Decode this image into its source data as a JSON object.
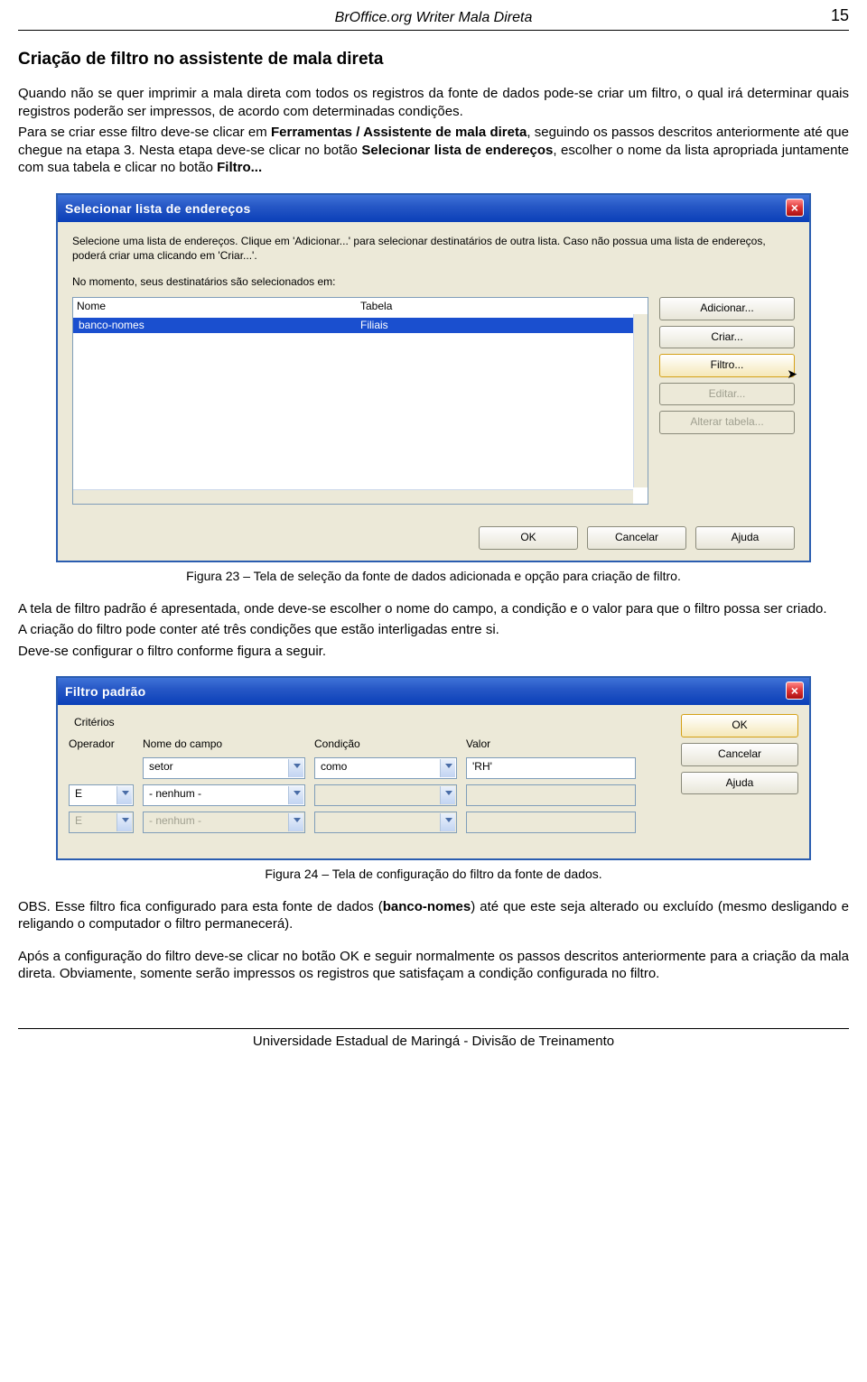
{
  "header": {
    "title": "BrOffice.org Writer Mala Direta",
    "page_no": "15"
  },
  "section_title": "Criação de filtro no assistente de mala direta",
  "para1_a": "Quando não se quer imprimir a mala direta com todos os registros da fonte de dados pode-se criar um filtro, o qual irá determinar quais registros poderão ser impressos, de acordo com determinadas condições.",
  "para1_b_pre": "Para se criar esse filtro deve-se clicar em ",
  "para1_b_bold": "Ferramentas / Assistente de mala direta",
  "para1_b_post": ", seguindo os passos descritos anteriormente até que chegue na etapa 3. Nesta etapa deve-se clicar no botão ",
  "para1_b_bold2": "Selecionar lista de endereços",
  "para1_b_post2": ", escolher o nome da lista apropriada juntamente com sua tabela e clicar no botão ",
  "para1_b_bold3": "Filtro...",
  "dialog1": {
    "title": "Selecionar lista de endereços",
    "intro": "Selecione uma lista de endereços. Clique em 'Adicionar...' para selecionar destinatários de outra lista. Caso não possua uma lista de endereços, poderá criar uma clicando em 'Criar...'.",
    "current_label": "No momento, seus destinatários são selecionados em:",
    "col_nome": "Nome",
    "col_tabela": "Tabela",
    "row_nome": "banco-nomes",
    "row_tabela": "Filiais",
    "btn_adicionar": "Adicionar...",
    "btn_criar": "Criar...",
    "btn_filtro": "Filtro...",
    "btn_editar": "Editar...",
    "btn_alterar": "Alterar tabela...",
    "btn_ok": "OK",
    "btn_cancelar": "Cancelar",
    "btn_ajuda": "Ajuda"
  },
  "caption1": "Figura 23 – Tela de seleção da fonte de dados adicionada e opção para criação de filtro.",
  "para2_a": "A tela de filtro padrão é apresentada, onde deve-se escolher o nome do campo, a condição e o valor para que o filtro possa ser criado.",
  "para2_b": "A criação do filtro pode conter até três condições que estão interligadas entre si.",
  "para2_c": "Deve-se configurar o filtro conforme figura a seguir.",
  "dialog2": {
    "title": "Filtro padrão",
    "criterios": "Critérios",
    "hdr_operador": "Operador",
    "hdr_campo": "Nome do campo",
    "hdr_condicao": "Condição",
    "hdr_valor": "Valor",
    "r1_field": "setor",
    "r1_cond": "como",
    "r1_val": "'RH'",
    "r2_op": "E",
    "r2_field": "- nenhum -",
    "r3_op": "E",
    "r3_field": "- nenhum -",
    "btn_ok": "OK",
    "btn_cancelar": "Cancelar",
    "btn_ajuda": "Ajuda"
  },
  "caption2": "Figura 24 – Tela de configuração do filtro da fonte de dados.",
  "para3_pre": "OBS. Esse filtro fica configurado para esta fonte de dados (",
  "para3_bold": "banco-nomes",
  "para3_post": ") até que este seja alterado ou excluído (mesmo desligando e religando o computador o filtro permanecerá).",
  "para4": "Após a configuração do filtro deve-se clicar no botão OK e seguir normalmente os passos descritos anteriormente para a criação da mala direta. Obviamente, somente serão impressos os registros que satisfaçam a condição configurada no filtro.",
  "footer": "Universidade Estadual de Maringá - Divisão de Treinamento"
}
